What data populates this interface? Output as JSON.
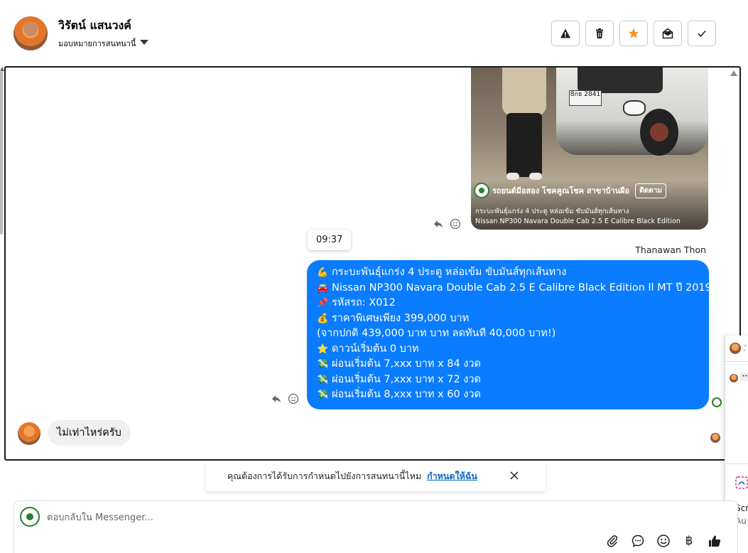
{
  "header": {
    "contact_name": "วิรัตน์ แสนวงค์",
    "assign_label": "มอบหมายการสนทนานี้",
    "actions": [
      {
        "name": "report-button",
        "icon": "warning-icon"
      },
      {
        "name": "delete-button",
        "icon": "trash-icon"
      },
      {
        "name": "star-button",
        "icon": "star-icon",
        "color": "#f7931e"
      },
      {
        "name": "mark-unread-button",
        "icon": "envelope-open-icon"
      },
      {
        "name": "mark-done-button",
        "icon": "check-icon"
      }
    ]
  },
  "shared_post": {
    "plate_text": "8กธ 2841",
    "page_name": "รถยนต์มือสอง โชคคูณโชค สาขาบ้านผือ",
    "follow_label": "ติดตาม",
    "caption_line1": "กระบะพันธุ์แกร่ง 4 ประตู หล่อเข้ม ขับมันส์ทุกเส้นทาง",
    "caption_line2": "Nissan NP300 Navara Double Cab 2.5 E Calibre Black Edition"
  },
  "messages": {
    "timestamp": "09:37",
    "sender_name": "Thanawan Thon",
    "outgoing_lines": [
      {
        "emoji": "💪",
        "text": "กระบะพันธุ์แกร่ง 4 ประตู หล่อเข้ม ขับมันส์ทุกเส้นทาง"
      },
      {
        "emoji": "🚘",
        "text": "Nissan NP300 Navara Double Cab 2.5 E Calibre Black Edition ll MT ปี 2019"
      },
      {
        "emoji": "📌",
        "text": "รหัสรถ: X012"
      },
      {
        "emoji": "💰",
        "text": "ราคาพิเศษเพียง 399,000 บาท"
      },
      {
        "emoji": "",
        "text": "(จากปกติ 439,000 บาท บาท ลดทันที 40,000 บาท!)"
      },
      {
        "emoji": "⭐",
        "text": "ดาวน์เริ่มต้น 0 บาท"
      },
      {
        "emoji": "💸",
        "text": "ผ่อนเริ่มต้น 7,xxx บาท x 84 งวด"
      },
      {
        "emoji": "💸",
        "text": "ผ่อนเริ่มต้น 7,xxx บาท x 72 งวด"
      },
      {
        "emoji": "💸",
        "text": "ผ่อนเริ่มต้น 8,xxx บาท x 60 งวด"
      }
    ],
    "incoming_text": "ไม่เท่าไหร่ครับ"
  },
  "right_panel": {
    "rp_text1": "Scr",
    "rp_text2": "Au",
    "rp_bubble": "•••"
  },
  "notice": {
    "text": "คุณต้องการได้รับการกำหนดไปยังการสนทนานี้ไหม",
    "link": "กำหนดให้ฉัน"
  },
  "composer": {
    "placeholder": "ตอบกลับใน Messenger...",
    "tools": [
      "paperclip-icon",
      "chat-bubble-icon",
      "emoji-icon",
      "baht-icon",
      "thumbs-up-icon"
    ],
    "baht_symbol": "฿"
  },
  "colors": {
    "outgoing_bubble": "#0a7cff",
    "incoming_bubble": "#f0f0f0",
    "star": "#f7931e",
    "link": "#0a66c2"
  }
}
